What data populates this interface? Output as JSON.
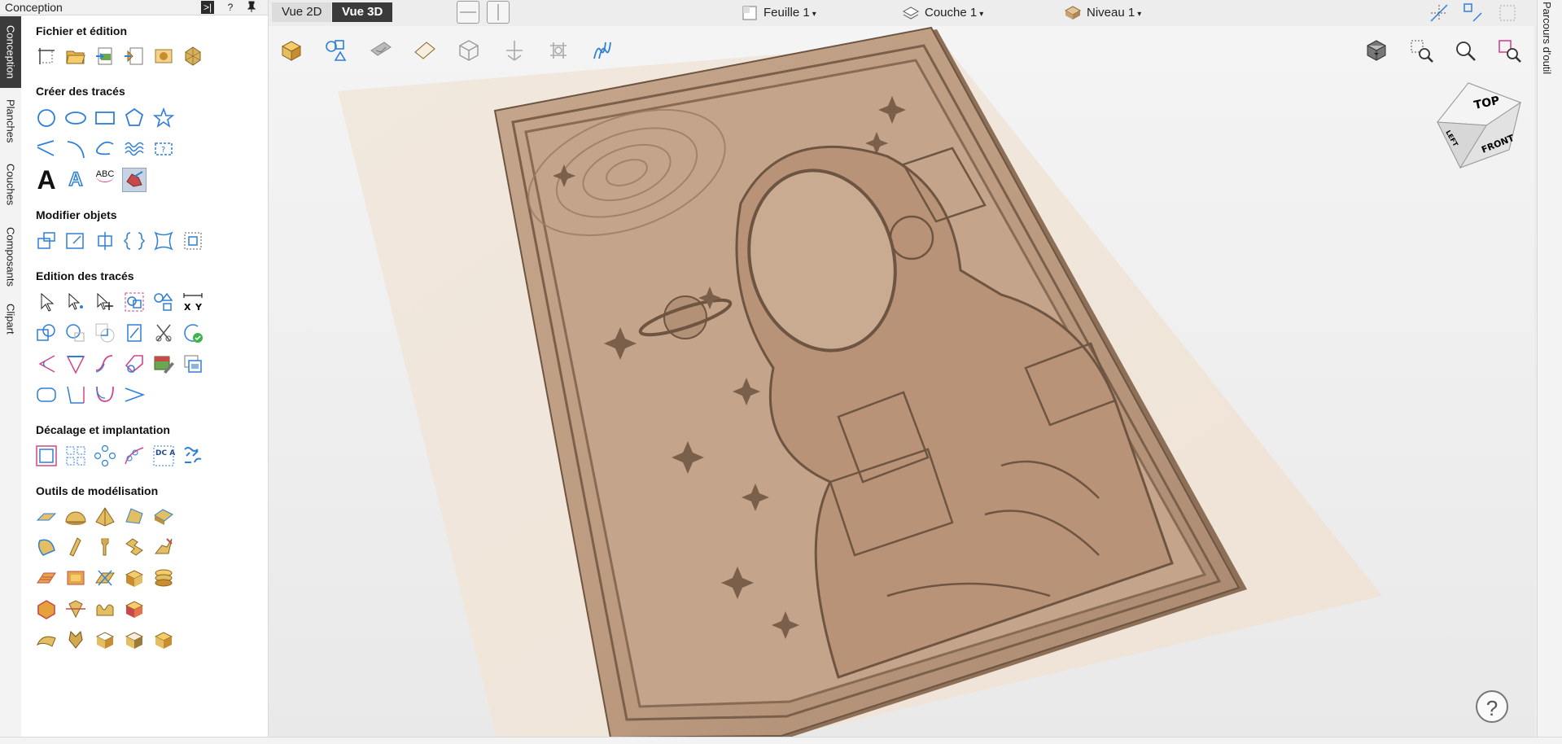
{
  "panel": {
    "title": "Conception",
    "header_buttons": [
      ">|",
      "?",
      "pin"
    ]
  },
  "left_tabs": [
    "Conception",
    "Planches",
    "Couches",
    "Composants",
    "Clipart"
  ],
  "right_tabs": [
    "Parcours d'outil"
  ],
  "sections": [
    {
      "title": "Fichier et édition"
    },
    {
      "title": "Créer des tracés"
    },
    {
      "title": "Modifier objets"
    },
    {
      "title": "Edition des tracés"
    },
    {
      "title": "Décalage et implantation"
    },
    {
      "title": "Outils de modélisation"
    }
  ],
  "tool_labels": {
    "text_big": "A",
    "text_outline": "A",
    "text_arc": "ABC",
    "xy_x": "X",
    "xy_y": "Y",
    "array_text": "DC AB"
  },
  "view_tabs": {
    "vue2d": "Vue 2D",
    "vue3d": "Vue 3D",
    "active": "Vue 3D"
  },
  "dropdowns": {
    "sheet": "Feuille 1",
    "layer": "Couche 1",
    "level": "Niveau 1",
    "caret": "▾"
  },
  "view_cube": {
    "top": "TOP",
    "front": "FRONT",
    "left": "LEFT"
  },
  "help": "?",
  "colors": {
    "accent": "#2f7fd6",
    "dark_tab": "#3a3a3a",
    "relief": "#c4a48a",
    "material": "#efe5db"
  }
}
